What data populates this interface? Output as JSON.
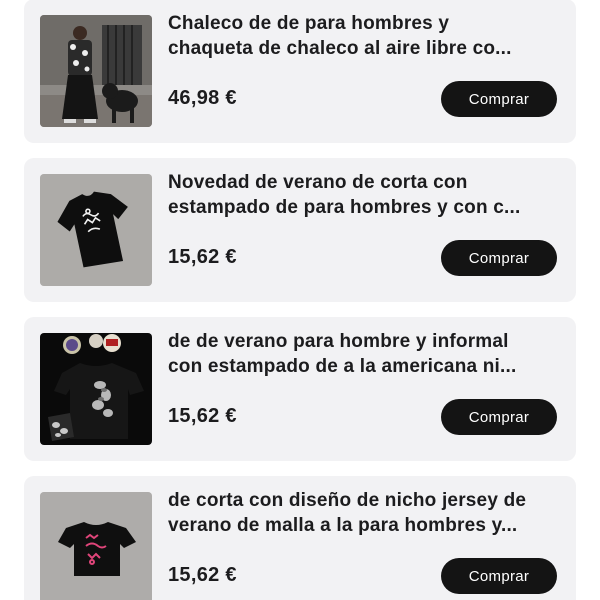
{
  "products": [
    {
      "title_lines": [
        "Chaleco de de para hombres y",
        "chaqueta de chaleco al aire libre co..."
      ],
      "price": "46,98 €",
      "button_label": "Comprar",
      "image": "man-in-patterned-vest-with-dog"
    },
    {
      "title_lines": [
        "Novedad de verano de corta con",
        "estampado de para hombres y con c..."
      ],
      "price": "15,62 €",
      "button_label": "Comprar",
      "image": "black-tshirt-with-white-print"
    },
    {
      "title_lines": [
        "de de verano para hombre y informal",
        "con estampado de a la americana ni..."
      ],
      "price": "15,62 €",
      "button_label": "Comprar",
      "image": "black-tshirt-with-camo-print-and-badges"
    },
    {
      "title_lines": [
        "de corta con diseño de nicho jersey de",
        "verano de malla a la para hombres y..."
      ],
      "price": "15,62 €",
      "button_label": "Comprar",
      "image": "black-tshirt-with-pink-print"
    }
  ],
  "colors": {
    "card_background": "#f2f2f4",
    "button_background": "#141414",
    "text": "#1c1c1e"
  }
}
